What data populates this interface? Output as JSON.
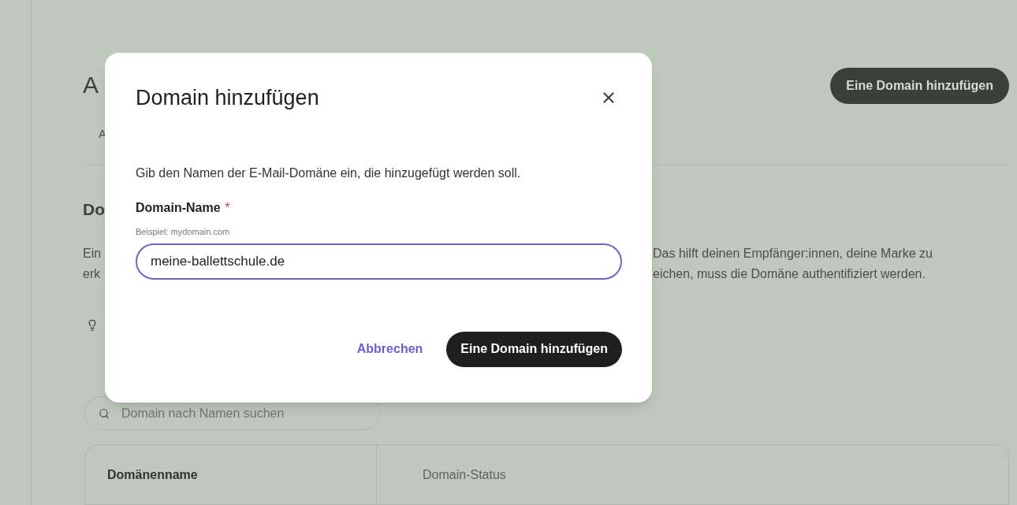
{
  "page": {
    "title_fragment": "A",
    "primary_button": "Eine Domain hinzufügen",
    "tab_fragment": "A",
    "section_heading_fragment": "Do",
    "description_lines": [
      {
        "left": "Ein",
        "right": "Das hilft deinen Empfänger:innen, deine Marke zu"
      },
      {
        "left": "erk",
        "right": "eichen, muss die Domäne authentifiziert werden."
      }
    ],
    "search": {
      "placeholder": "Domain nach Namen suchen"
    },
    "table": {
      "columns": [
        {
          "label": "Domänenname",
          "sorted": true
        },
        {
          "label": "Domain-Status",
          "sorted": false
        }
      ]
    }
  },
  "dialog": {
    "title": "Domain hinzufügen",
    "description": "Gib den Namen der E-Mail-Domäne ein, die hinzugefügt werden soll.",
    "field": {
      "label": "Domain-Name",
      "required_mark": "*",
      "hint": "Beispiel: mydomain.com",
      "value": "meine-ballettschule.de",
      "focused": true
    },
    "buttons": [
      {
        "label": "Abbrechen",
        "kind": "link"
      },
      {
        "label": "Eine Domain hinzufügen",
        "kind": "primary"
      }
    ]
  }
}
